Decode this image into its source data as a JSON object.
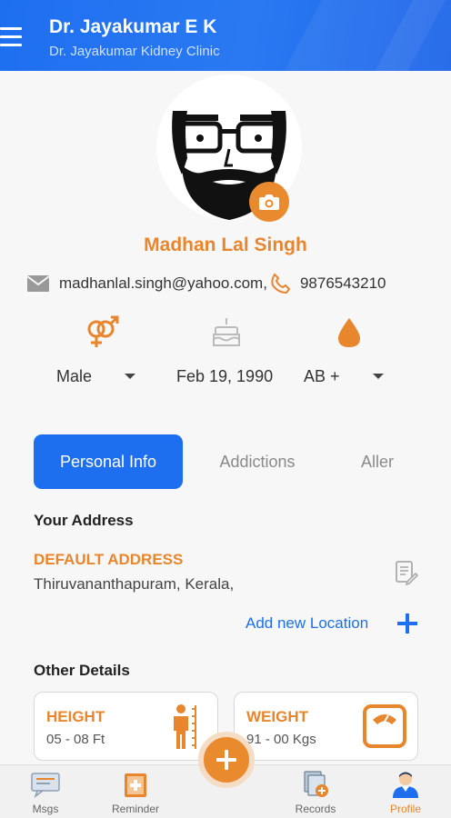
{
  "header": {
    "doctor_name": "Dr. Jayakumar E K",
    "clinic_name": "Dr. Jayakumar Kidney Clinic"
  },
  "profile": {
    "name": "Madhan Lal Singh",
    "email": "madhanlal.singh@yahoo.com,",
    "phone": "9876543210",
    "gender": "Male",
    "dob": "Feb 19, 1990",
    "blood_group": "AB +"
  },
  "tabs": [
    {
      "label": "Personal Info",
      "active": true
    },
    {
      "label": "Addictions",
      "active": false
    },
    {
      "label": "Aller",
      "active": false
    }
  ],
  "address": {
    "section_title": "Your Address",
    "label": "DEFAULT ADDRESS",
    "text": "Thiruvananthapuram, Kerala,",
    "add_new": "Add new Location"
  },
  "other_details": {
    "section_title": "Other Details",
    "height_label": "HEIGHT",
    "height_value": "05 - 08 Ft",
    "weight_label": "WEIGHT",
    "weight_value": "91 - 00 Kgs"
  },
  "bottom_nav": [
    {
      "label": "Msgs",
      "icon": "message-icon"
    },
    {
      "label": "Reminder",
      "icon": "reminder-icon"
    },
    {
      "label": "Records",
      "icon": "records-icon"
    },
    {
      "label": "Profile",
      "icon": "profile-icon",
      "active": true
    }
  ],
  "colors": {
    "primary": "#1e6ff0",
    "accent": "#e8862e"
  }
}
